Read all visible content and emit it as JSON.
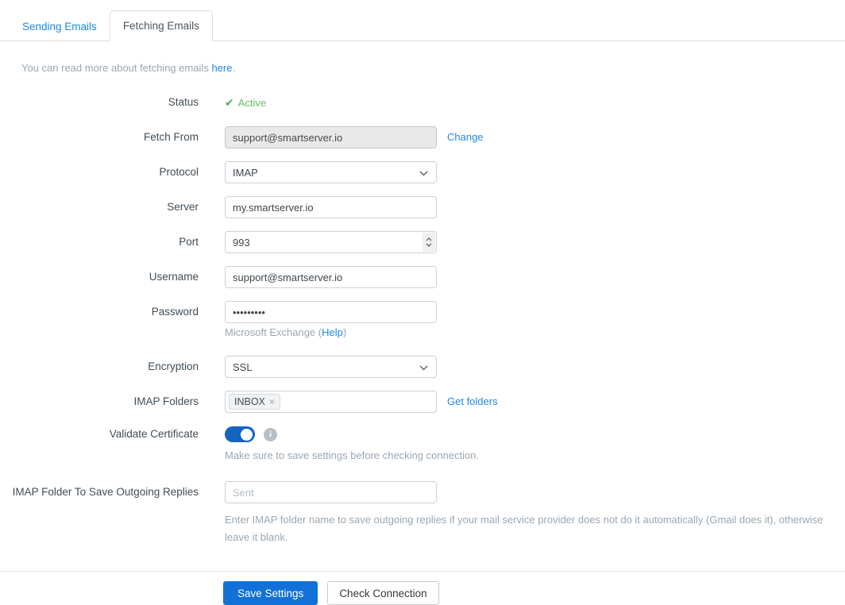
{
  "tabs": [
    {
      "label": "Sending Emails",
      "active": false
    },
    {
      "label": "Fetching Emails",
      "active": true
    }
  ],
  "intro": {
    "text": "You can read more about fetching emails ",
    "link": "here",
    "suffix": "."
  },
  "form": {
    "status": {
      "label": "Status",
      "check_icon": "✔",
      "value": "Active"
    },
    "fetch_from": {
      "label": "Fetch From",
      "value": "support@smartserver.io",
      "action": "Change"
    },
    "protocol": {
      "label": "Protocol",
      "value": "IMAP"
    },
    "server": {
      "label": "Server",
      "value": "my.smartserver.io"
    },
    "port": {
      "label": "Port",
      "value": "993"
    },
    "username": {
      "label": "Username",
      "value": "support@smartserver.io"
    },
    "password": {
      "label": "Password",
      "value": "•••••••••",
      "note_text": "Microsoft Exchange (",
      "note_link": "Help",
      "note_suffix": ")"
    },
    "encryption": {
      "label": "Encryption",
      "value": "SSL"
    },
    "imap_folders": {
      "label": "IMAP Folders",
      "tags": [
        "INBOX"
      ],
      "remove_glyph": "×",
      "action": "Get folders"
    },
    "validate_certificate": {
      "label": "Validate Certificate",
      "state": "on",
      "note": "Make sure to save settings before checking connection."
    },
    "imap_save_folder": {
      "label": "IMAP Folder To Save Outgoing Replies",
      "placeholder": "Sent",
      "help": "Enter IMAP folder name to save outgoing replies if your mail service provider does not do it automatically (Gmail does it), otherwise leave it blank."
    }
  },
  "footer": {
    "save_label": "Save Settings",
    "check_label": "Check Connection"
  },
  "colors": {
    "link_blue": "#1e88e5",
    "success_green": "#66bb6a",
    "primary_button_blue": "#1271d6",
    "toggle_blue": "#1565c0",
    "muted_text": "#9aa7b2"
  }
}
